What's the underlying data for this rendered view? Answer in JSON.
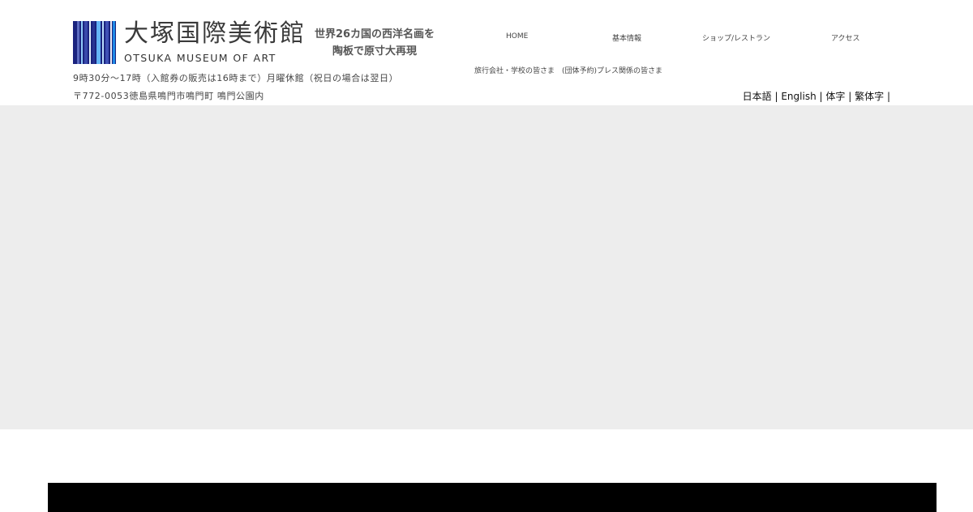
{
  "logo": {
    "jp": "大塚国際美術館",
    "en": "OTSUKA MUSEUM OF ART"
  },
  "tagline": {
    "line1": "世界26カ国の西洋名画を",
    "line2": "陶板で原寸大再現"
  },
  "info": {
    "hours": "9時30分～17時（入館券の販売は16時まで）月曜休館（祝日の場合は翌日）",
    "address": "〒772-0053徳島県鳴門市鳴門町 鳴門公園内"
  },
  "nav": {
    "home": "HOME",
    "basic": "基本情報",
    "shop": "ショップ/レストラン",
    "access": "アクセス",
    "travel": "旅行会社・学校の皆さま",
    "group": "(団体予約)プレス関係の皆さま"
  },
  "lang": {
    "ja": "日本語",
    "en": "English",
    "zh_s": "体字",
    "zh_t": "繁体字",
    "sep": "|"
  },
  "colors": {
    "hero_bg": "#ededed",
    "logo_dark": "#1a237e",
    "logo_mid": "#3f51b5",
    "logo_light": "#90caf9"
  }
}
